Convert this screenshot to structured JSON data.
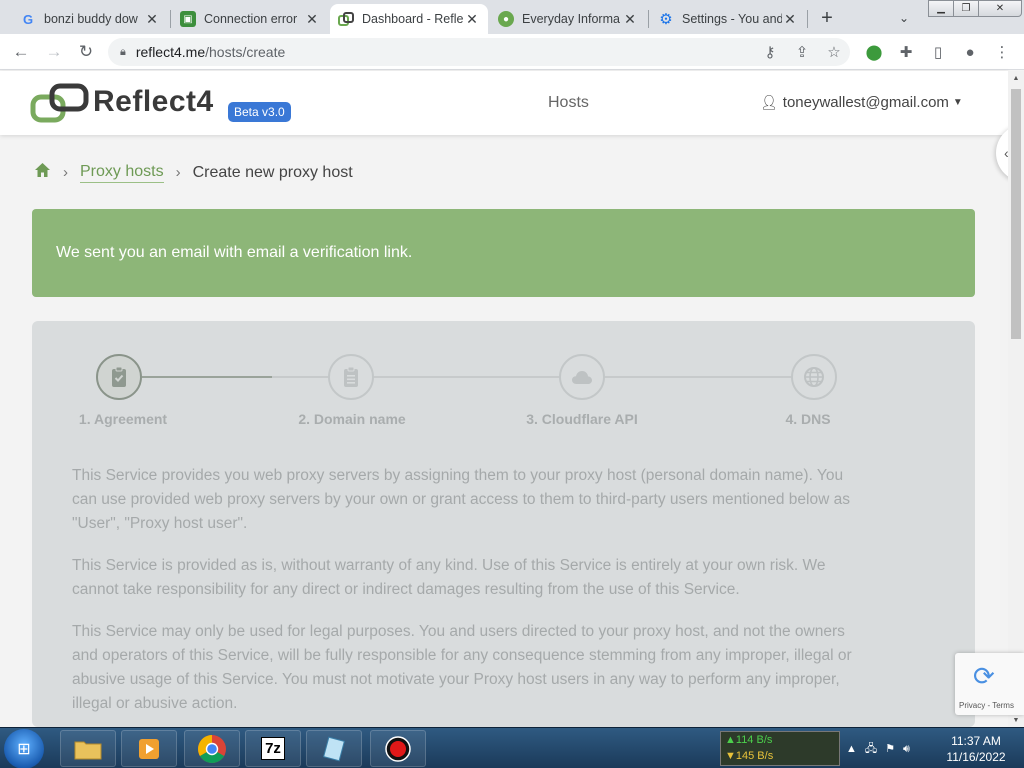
{
  "browser": {
    "tabs": [
      {
        "title": "bonzi buddy dow",
        "favicon": "G"
      },
      {
        "title": "Connection error",
        "favicon": "connection-error"
      },
      {
        "title": "Dashboard - Refle",
        "favicon": "reflect4"
      },
      {
        "title": "Everyday Informa",
        "favicon": "person"
      },
      {
        "title": "Settings - You and",
        "favicon": "gear"
      }
    ],
    "new_tab_label": "+",
    "address": {
      "host": "reflect4.me",
      "path": "/hosts/create"
    }
  },
  "site": {
    "brand": "Reflect4",
    "beta_badge": "Beta v3.0",
    "nav_hosts": "Hosts",
    "user_email": "toneywallest@gmail.com",
    "accent_color": "#8db678"
  },
  "breadcrumb": {
    "link": "Proxy hosts",
    "current": "Create new proxy host"
  },
  "alert": {
    "message": "We sent you an email with email a verification link."
  },
  "wizard": {
    "steps": [
      {
        "label": "1. Agreement",
        "icon": "clipboard-check-icon",
        "active": true
      },
      {
        "label": "2. Domain name",
        "icon": "clipboard-list-icon",
        "active": false
      },
      {
        "label": "3. Cloudflare API",
        "icon": "cloud-icon",
        "active": false
      },
      {
        "label": "4. DNS",
        "icon": "globe-icon",
        "active": false
      }
    ],
    "terms": [
      "This Service provides you web proxy servers by assigning them to your proxy host (personal domain name). You can use provided web proxy servers by your own or grant access to them to third-party users mentioned below as \"User\", \"Proxy host user\".",
      "This Service is provided as is, without warranty of any kind. Use of this Service is entirely at your own risk. We cannot take responsibility for any direct or indirect damages resulting from the use of this Service.",
      "This Service may only be used for legal purposes. You and users directed to your proxy host, and not the owners and operators of this Service, will be fully responsible for any consequence stemming from any improper, illegal or abusive usage of this Service. You must not motivate your Proxy host users in any way to perform any improper, illegal or abusive action."
    ]
  },
  "recaptcha": {
    "links": "Privacy - Terms"
  },
  "taskbar": {
    "apps": [
      "explorer",
      "media-player",
      "chrome",
      "7z",
      "notepad",
      "recorder"
    ],
    "app_7z_label": "7z",
    "net_up": "▲114 B/s",
    "net_down": "▼145 B/s",
    "time": "11:37 AM",
    "date": "11/16/2022"
  }
}
